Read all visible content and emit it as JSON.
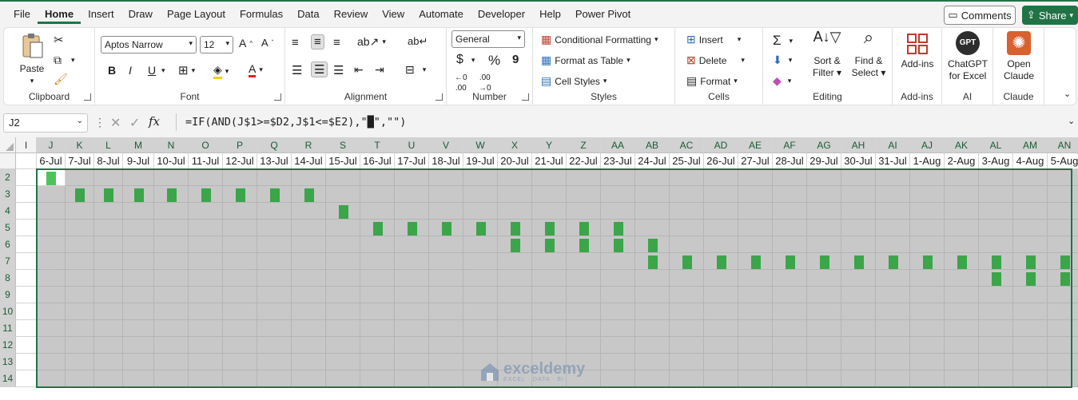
{
  "menu": [
    "File",
    "Home",
    "Insert",
    "Draw",
    "Page Layout",
    "Formulas",
    "Data",
    "Review",
    "View",
    "Automate",
    "Developer",
    "Help",
    "Power Pivot"
  ],
  "active_tab": "Home",
  "comments_label": "Comments",
  "share_label": "Share",
  "ribbon": {
    "clipboard": {
      "paste": "Paste",
      "label": "Clipboard"
    },
    "font": {
      "name": "Aptos Narrow",
      "size": "12",
      "label": "Font",
      "bold": "B",
      "italic": "I",
      "underline": "U"
    },
    "alignment": {
      "label": "Alignment"
    },
    "number": {
      "format": "General",
      "label": "Number",
      "currency": "$",
      "percent": "%",
      "comma": "9"
    },
    "styles": {
      "conditional": "Conditional Formatting",
      "table": "Format as Table",
      "cell_styles": "Cell Styles",
      "label": "Styles"
    },
    "cells": {
      "insert": "Insert",
      "delete": "Delete",
      "format": "Format",
      "label": "Cells"
    },
    "editing": {
      "sort": "Sort &",
      "sort2": "Filter",
      "find": "Find &",
      "find2": "Select",
      "label": "Editing"
    },
    "addins": {
      "btn": "Add-ins",
      "label": "Add-ins"
    },
    "ai": {
      "btn1": "ChatGPT",
      "btn2": "for Excel",
      "label": "AI",
      "logo": "GPT"
    },
    "claude": {
      "btn1": "Open",
      "btn2": "Claude",
      "label": "Claude"
    }
  },
  "formula_bar": {
    "name_box": "J2",
    "formula": "=IF(AND(J$1>=$D2,J$1<=$E2),\"█\",\"\")",
    "fx": "fx"
  },
  "columns": [
    {
      "letter": "I",
      "date": ""
    },
    {
      "letter": "J",
      "date": "6-Jul"
    },
    {
      "letter": "K",
      "date": "7-Jul"
    },
    {
      "letter": "L",
      "date": "8-Jul"
    },
    {
      "letter": "M",
      "date": "9-Jul"
    },
    {
      "letter": "N",
      "date": "10-Jul"
    },
    {
      "letter": "O",
      "date": "11-Jul"
    },
    {
      "letter": "P",
      "date": "12-Jul"
    },
    {
      "letter": "Q",
      "date": "13-Jul"
    },
    {
      "letter": "R",
      "date": "14-Jul"
    },
    {
      "letter": "S",
      "date": "15-Jul"
    },
    {
      "letter": "T",
      "date": "16-Jul"
    },
    {
      "letter": "U",
      "date": "17-Jul"
    },
    {
      "letter": "V",
      "date": "18-Jul"
    },
    {
      "letter": "W",
      "date": "19-Jul"
    },
    {
      "letter": "X",
      "date": "20-Jul"
    },
    {
      "letter": "Y",
      "date": "21-Jul"
    },
    {
      "letter": "Z",
      "date": "22-Jul"
    },
    {
      "letter": "AA",
      "date": "23-Jul"
    },
    {
      "letter": "AB",
      "date": "24-Jul"
    },
    {
      "letter": "AC",
      "date": "25-Jul"
    },
    {
      "letter": "AD",
      "date": "26-Jul"
    },
    {
      "letter": "AE",
      "date": "27-Jul"
    },
    {
      "letter": "AF",
      "date": "28-Jul"
    },
    {
      "letter": "AG",
      "date": "29-Jul"
    },
    {
      "letter": "AH",
      "date": "30-Jul"
    },
    {
      "letter": "AI",
      "date": "31-Jul"
    },
    {
      "letter": "AJ",
      "date": "1-Aug"
    },
    {
      "letter": "AK",
      "date": "2-Aug"
    },
    {
      "letter": "AL",
      "date": "3-Aug"
    },
    {
      "letter": "AM",
      "date": "4-Aug"
    },
    {
      "letter": "AN",
      "date": "5-Aug"
    }
  ],
  "rows": [
    "2",
    "3",
    "4",
    "5",
    "6",
    "7",
    "8",
    "9",
    "10",
    "11",
    "12",
    "13",
    "14"
  ],
  "gantt": {
    "2": [
      "J"
    ],
    "3": [
      "K",
      "L",
      "M",
      "N",
      "O",
      "P",
      "Q",
      "R"
    ],
    "4": [
      "S"
    ],
    "5": [
      "T",
      "U",
      "V",
      "W",
      "X",
      "Y",
      "Z",
      "AA"
    ],
    "6": [
      "X",
      "Y",
      "Z",
      "AA",
      "AB"
    ],
    "7": [
      "AB",
      "AC",
      "AD",
      "AE",
      "AF",
      "AG",
      "AH",
      "AI",
      "AJ",
      "AK",
      "AL",
      "AM",
      "AN"
    ],
    "8": [
      "AL",
      "AM",
      "AN"
    ]
  },
  "colors": {
    "accent": "#217346",
    "bar": "#3ba54a",
    "shade": "#c8c8c8"
  },
  "watermark": {
    "name": "exceldemy",
    "tagline": "EXCEL · DATA · BI"
  }
}
